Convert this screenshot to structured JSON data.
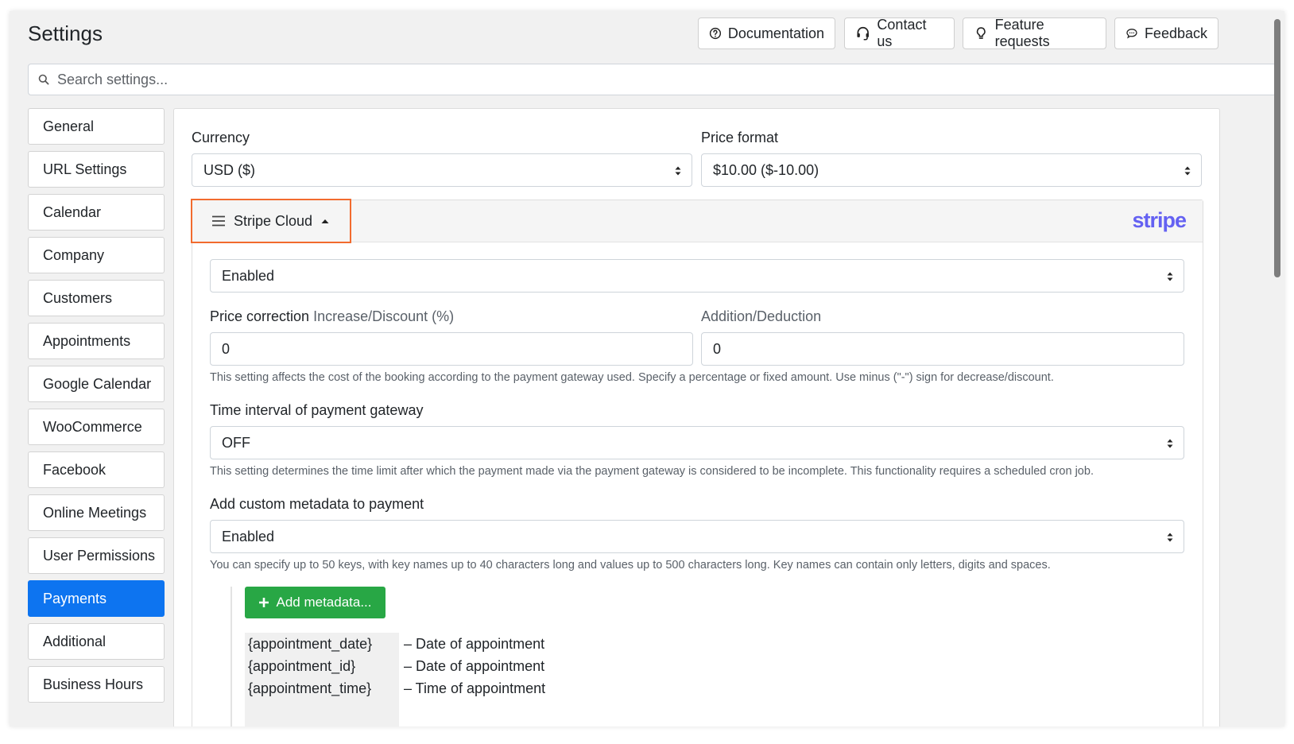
{
  "header": {
    "title": "Settings",
    "buttons": {
      "documentation": "Documentation",
      "contact": "Contact us",
      "feature_requests": "Feature requests",
      "feedback": "Feedback"
    }
  },
  "search": {
    "placeholder": "Search settings..."
  },
  "sidebar": {
    "active": "Payments",
    "items": [
      "General",
      "URL Settings",
      "Calendar",
      "Company",
      "Customers",
      "Appointments",
      "Google Calendar",
      "WooCommerce",
      "Facebook",
      "Online Meetings",
      "User Permissions",
      "Payments",
      "Additional",
      "Business Hours"
    ]
  },
  "payments": {
    "currency_label": "Currency",
    "currency_value": "USD ($)",
    "price_format_label": "Price format",
    "price_format_value": "$10.00 ($-10.00)",
    "gateway": {
      "name": "Stripe Cloud",
      "logo_text": "stripe",
      "status": "Enabled",
      "price_correction_label": "Price correction",
      "price_correction_sub": "Increase/Discount (%)",
      "percent_value": "0",
      "addition_label": "Addition/Deduction",
      "addition_value": "0",
      "price_correction_help": "This setting affects the cost of the booking according to the payment gateway used. Specify a percentage or fixed amount. Use minus (\"-\") sign for decrease/discount.",
      "time_interval_label": "Time interval of payment gateway",
      "time_interval_value": "OFF",
      "time_interval_help": "This setting determines the time limit after which the payment made via the payment gateway is considered to be incomplete. This functionality requires a scheduled cron job.",
      "metadata_label": "Add custom metadata to payment",
      "metadata_value": "Enabled",
      "metadata_help": "You can specify up to 50 keys, with key names up to 40 characters long and values up to 500 characters long. Key names can contain only letters, digits and spaces.",
      "add_metadata_button": "Add metadata...",
      "placeholders": [
        {
          "key": "{appointment_date}",
          "desc": "– Date of appointment"
        },
        {
          "key": "{appointment_id}",
          "desc": "– Date of appointment"
        },
        {
          "key": "{appointment_time}",
          "desc": "– Time of appointment"
        }
      ]
    }
  },
  "colors": {
    "accent": "#0d74f0",
    "highlight": "#f26b2e",
    "stripe": "#6461f2",
    "success": "#28a745"
  }
}
